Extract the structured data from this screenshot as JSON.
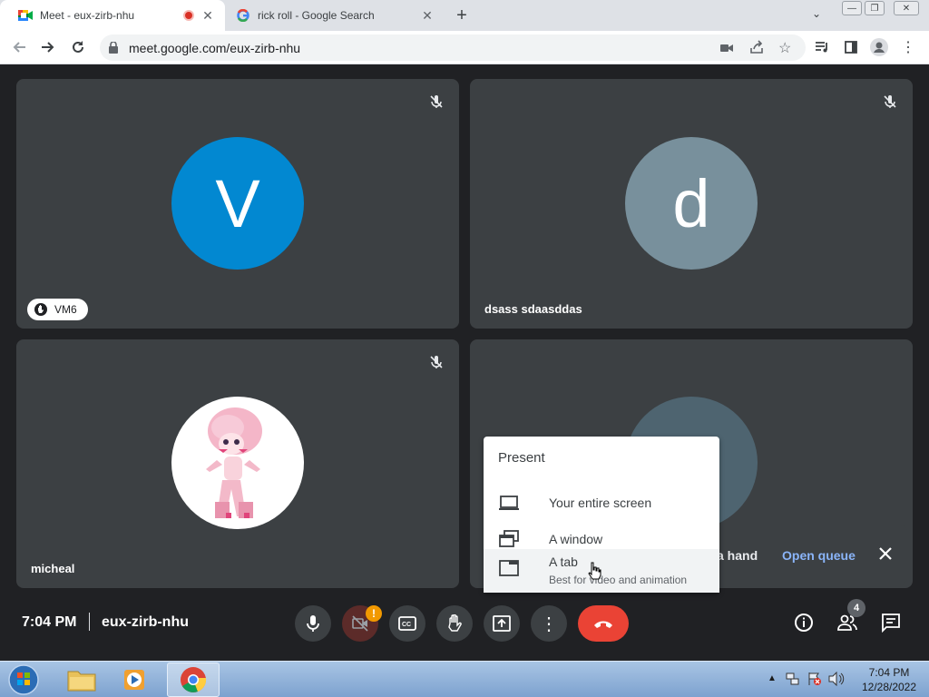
{
  "browser": {
    "tabs": [
      {
        "title": "Meet - eux-zirb-nhu",
        "favicon": "google-meet-icon",
        "recording": true
      },
      {
        "title": "rick roll - Google Search",
        "favicon": "google-icon"
      }
    ],
    "url": "meet.google.com/eux-zirb-nhu"
  },
  "participants": [
    {
      "initial": "V",
      "avatar_color": "#0288d1",
      "label": "VM6",
      "hand_raised": true,
      "muted": true
    },
    {
      "initial": "d",
      "avatar_color": "#78909c",
      "name": "dsass sdaasddas",
      "muted": true
    },
    {
      "name": "micheal",
      "avatar": "image",
      "muted": true
    }
  ],
  "raise_hand_bar": {
    "text": "a hand",
    "action": "Open queue"
  },
  "present_menu": {
    "title": "Present",
    "items": [
      {
        "label": "Your entire screen",
        "icon": "laptop-icon"
      },
      {
        "label": "A window",
        "icon": "window-icon"
      },
      {
        "label": "A tab",
        "icon": "tab-icon",
        "subtitle": "Best for video and animation",
        "highlighted": true
      }
    ]
  },
  "bottom_bar": {
    "time": "7:04 PM",
    "meeting_code": "eux-zirb-nhu",
    "people_count": "4",
    "camera_warning": "!"
  },
  "taskbar": {
    "clock_time": "7:04 PM",
    "clock_date": "12/28/2022"
  },
  "colors": {
    "end_call": "#ea4335",
    "accent_link": "#8ab4f8",
    "warning_badge": "#f29900"
  }
}
